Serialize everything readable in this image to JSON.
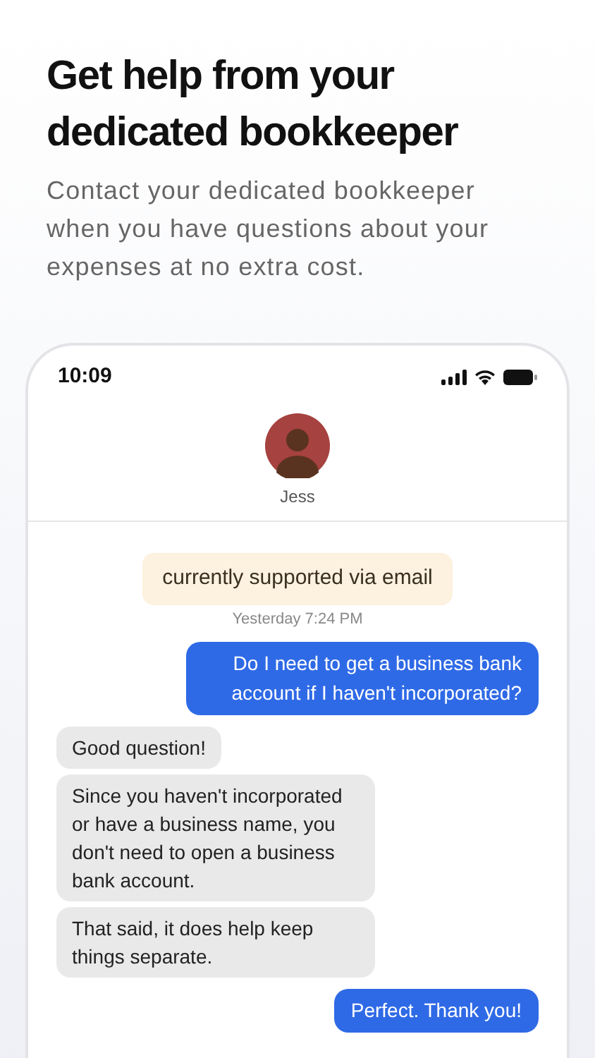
{
  "headline": "Get help from your dedicated bookkeeper",
  "description": "Contact your dedicated bookkeeper when you have questions about your expenses at no extra cost.",
  "phone": {
    "status_bar": {
      "time": "10:09"
    },
    "contact": {
      "name": "Jess"
    },
    "notice": "currently supported via email",
    "timestamp": "Yesterday 7:24 PM",
    "messages": [
      {
        "kind": "sent",
        "text": "Do I need to get a business bank account if I haven't incorporated?"
      },
      {
        "kind": "received",
        "text": "Good question!"
      },
      {
        "kind": "received",
        "text": "Since you haven't incorporated or have a business name, you don't need to open a business bank account."
      },
      {
        "kind": "received",
        "text": "That said, it does help keep things separate."
      },
      {
        "kind": "sent",
        "text": "Perfect. Thank you!"
      }
    ]
  }
}
